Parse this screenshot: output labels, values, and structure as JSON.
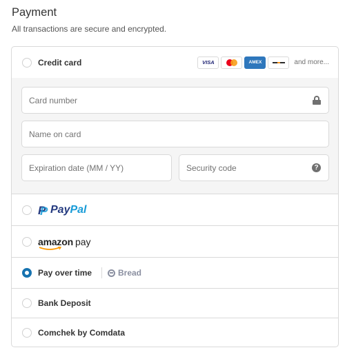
{
  "header": {
    "title": "Payment",
    "subtitle": "All transactions are secure and encrypted."
  },
  "methods": {
    "credit_card": {
      "label": "Credit card",
      "selected": false,
      "card_brands": [
        "VISA",
        "mastercard",
        "AMEX",
        "discover"
      ],
      "and_more": "and more..."
    },
    "card_form": {
      "card_number_placeholder": "Card number",
      "name_placeholder": "Name on card",
      "expiration_placeholder": "Expiration date (MM / YY)",
      "security_placeholder": "Security code",
      "help_glyph": "?",
      "icons": [
        "lock-icon",
        "help-icon"
      ]
    },
    "paypal": {
      "logo_pay": "Pay",
      "logo_pal": "Pal",
      "selected": false
    },
    "amazon_pay": {
      "logo_amazon": "amazon",
      "logo_pay": "pay",
      "selected": false
    },
    "pay_over_time": {
      "label": "Pay over time",
      "provider": "Bread",
      "selected": true
    },
    "bank_deposit": {
      "label": "Bank Deposit",
      "selected": false
    },
    "comchek": {
      "label": "Comchek by Comdata",
      "selected": false
    }
  },
  "colors": {
    "accent": "#1773b0",
    "border": "#d9d9d9",
    "form_bg": "#f5f5f5",
    "paypal_dark": "#253b80",
    "paypal_light": "#179bd7",
    "amex": "#2e77bc"
  }
}
